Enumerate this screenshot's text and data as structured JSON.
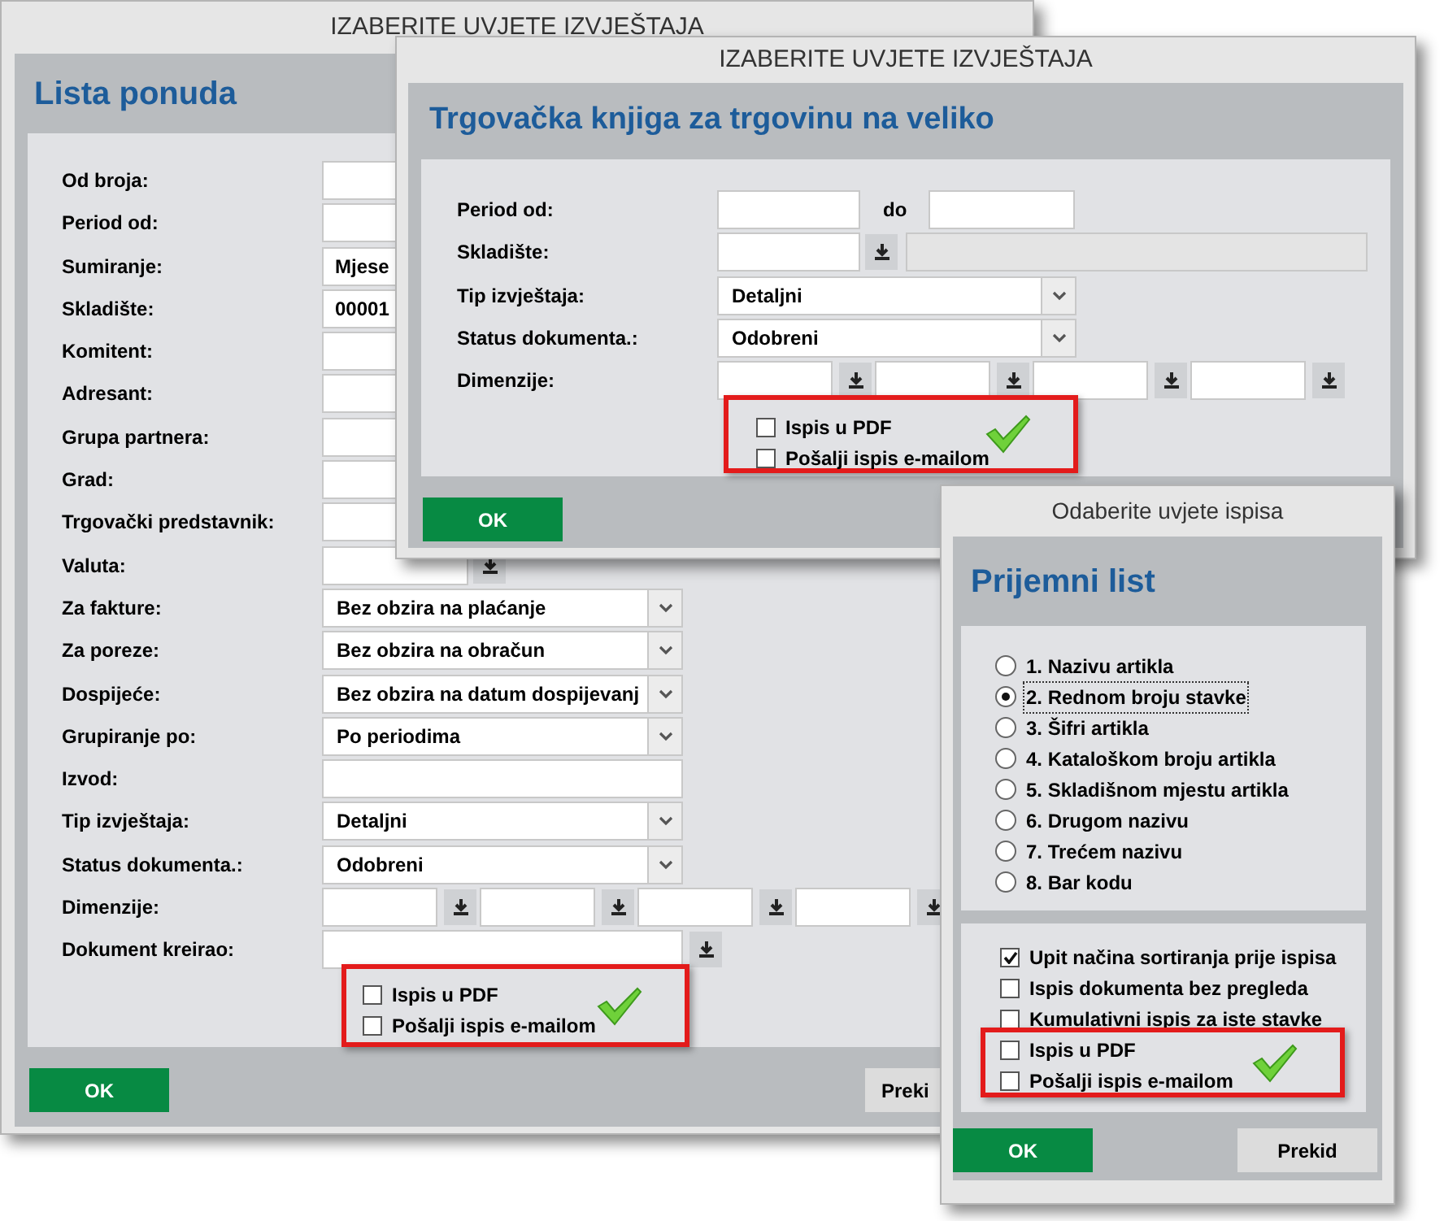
{
  "windows": [
    {
      "kind": "report_form",
      "title": "IZABERITE UVJETE IZVJEŠTAJA",
      "heading": "Lista ponuda",
      "fields": [
        {
          "label": "Od broja:",
          "kind": "text"
        },
        {
          "label": "Period od:",
          "kind": "text"
        },
        {
          "label": "Sumiranje:",
          "kind": "text",
          "value": "Mjese"
        },
        {
          "label": "Skladište:",
          "kind": "text",
          "value": "00001"
        },
        {
          "label": "Komitent:",
          "kind": "text"
        },
        {
          "label": "Adresant:",
          "kind": "text"
        },
        {
          "label": "Grupa partnera:",
          "kind": "text"
        },
        {
          "label": "Grad:",
          "kind": "text"
        },
        {
          "label": "Trgovački predstavnik:",
          "kind": "text"
        },
        {
          "label": "Valuta:",
          "kind": "lookup"
        },
        {
          "label": "Za fakture:",
          "kind": "dropdown",
          "value": "Bez obzira na plaćanje"
        },
        {
          "label": "Za poreze:",
          "kind": "dropdown",
          "value": "Bez obzira na obračun"
        },
        {
          "label": "Dospijeće:",
          "kind": "dropdown",
          "value": "Bez obzira na datum dospijevanj"
        },
        {
          "label": "Grupiranje po:",
          "kind": "dropdown",
          "value": "Po periodima"
        },
        {
          "label": "Izvod:",
          "kind": "text"
        },
        {
          "label": "Tip izvještaja:",
          "kind": "dropdown",
          "value": "Detaljni"
        },
        {
          "label": "Status dokumenta.:",
          "kind": "dropdown",
          "value": "Odobreni"
        },
        {
          "label": "Dimenzije:",
          "kind": "dimensions"
        },
        {
          "label": "Dokument kreirao:",
          "kind": "lookup_long"
        }
      ],
      "export_options": [
        {
          "label": "Ispis u PDF",
          "checked": false
        },
        {
          "label": "Pošalji ispis e-mailom",
          "checked": false
        }
      ],
      "buttons": [
        {
          "label": "OK",
          "kind": "primary"
        },
        {
          "label": "Preki",
          "kind": "secondary"
        }
      ]
    },
    {
      "kind": "report_form",
      "title": "IZABERITE UVJETE IZVJEŠTAJA",
      "heading": "Trgovačka knjiga za trgovinu na veliko",
      "fields": [
        {
          "label": "Period od:",
          "kind": "period",
          "to_label": "do"
        },
        {
          "label": "Skladište:",
          "kind": "lookup_extra"
        },
        {
          "label": "Tip izvještaja:",
          "kind": "dropdown",
          "value": "Detaljni"
        },
        {
          "label": "Status dokumenta.:",
          "kind": "dropdown",
          "value": "Odobreni"
        },
        {
          "label": "Dimenzije:",
          "kind": "dimensions"
        }
      ],
      "export_options": [
        {
          "label": "Ispis u PDF",
          "checked": false
        },
        {
          "label": "Pošalji ispis e-mailom",
          "checked": false
        }
      ],
      "buttons": [
        {
          "label": "OK",
          "kind": "primary"
        }
      ]
    },
    {
      "kind": "print_options",
      "title": "Odaberite uvjete ispisa",
      "heading": "Prijemni list",
      "sort_options": [
        {
          "label": "1. Nazivu artikla",
          "selected": false
        },
        {
          "label": "2. Rednom broju stavke",
          "selected": true
        },
        {
          "label": "3. Šifri artikla",
          "selected": false
        },
        {
          "label": "4. Kataloškom broju artikla",
          "selected": false
        },
        {
          "label": "5. Skladišnom mjestu artikla",
          "selected": false
        },
        {
          "label": "6. Drugom nazivu",
          "selected": false
        },
        {
          "label": "7. Trećem nazivu",
          "selected": false
        },
        {
          "label": "8. Bar kodu",
          "selected": false
        }
      ],
      "options": [
        {
          "label": "Upit načina sortiranja prije ispisa",
          "checked": true
        },
        {
          "label": "Ispis dokumenta bez pregleda",
          "checked": false
        },
        {
          "label": "Kumulativni ispis za iste stavke",
          "checked": false
        }
      ],
      "export_options": [
        {
          "label": "Ispis u PDF",
          "checked": false
        },
        {
          "label": "Pošalji ispis e-mailom",
          "checked": false
        }
      ],
      "buttons": [
        {
          "label": "OK",
          "kind": "primary"
        },
        {
          "label": "Prekid",
          "kind": "secondary"
        }
      ]
    }
  ]
}
